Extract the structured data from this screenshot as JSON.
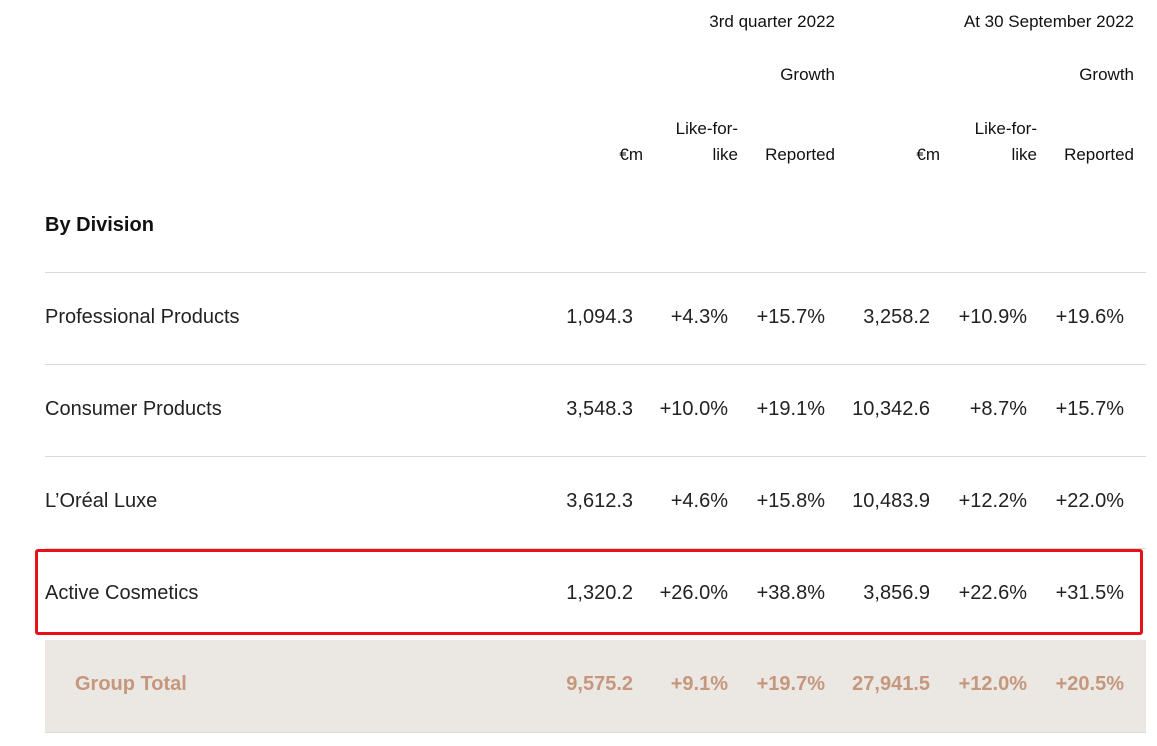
{
  "header": {
    "period_q3": "3rd quarter 2022",
    "period_ytd": "At 30 September 2022",
    "growth_q3": "Growth",
    "growth_ytd": "Growth",
    "col_eur_q3": "€m",
    "col_lfl_q3_line1": "Like-for-",
    "col_lfl_q3_line2": "like",
    "col_rep_q3": "Reported",
    "col_eur_ytd": "€m",
    "col_lfl_ytd_line1": "Like-for-",
    "col_lfl_ytd_line2": "like",
    "col_rep_ytd": "Reported"
  },
  "section_title": "By Division",
  "rows": [
    {
      "label": "Professional Products",
      "q3_eur": "1,094.3",
      "q3_lfl": "+4.3%",
      "q3_rep": "+15.7%",
      "ytd_eur": "3,258.2",
      "ytd_lfl": "+10.9%",
      "ytd_rep": "+19.6%"
    },
    {
      "label": "Consumer Products",
      "q3_eur": "3,548.3",
      "q3_lfl": "+10.0%",
      "q3_rep": "+19.1%",
      "ytd_eur": "10,342.6",
      "ytd_lfl": "+8.7%",
      "ytd_rep": "+15.7%"
    },
    {
      "label": "L’Oréal Luxe",
      "q3_eur": "3,612.3",
      "q3_lfl": "+4.6%",
      "q3_rep": "+15.8%",
      "ytd_eur": "10,483.9",
      "ytd_lfl": "+12.2%",
      "ytd_rep": "+22.0%"
    },
    {
      "label": "Active Cosmetics",
      "q3_eur": "1,320.2",
      "q3_lfl": "+26.0%",
      "q3_rep": "+38.8%",
      "ytd_eur": "3,856.9",
      "ytd_lfl": "+22.6%",
      "ytd_rep": "+31.5%"
    }
  ],
  "total": {
    "label": "Group Total",
    "q3_eur": "9,575.2",
    "q3_lfl": "+9.1%",
    "q3_rep": "+19.7%",
    "ytd_eur": "27,941.5",
    "ytd_lfl": "+12.0%",
    "ytd_rep": "+20.5%"
  },
  "colors": {
    "highlight": "#e8101a",
    "total_text": "#c5977d",
    "total_bg": "#ebe7e3"
  }
}
